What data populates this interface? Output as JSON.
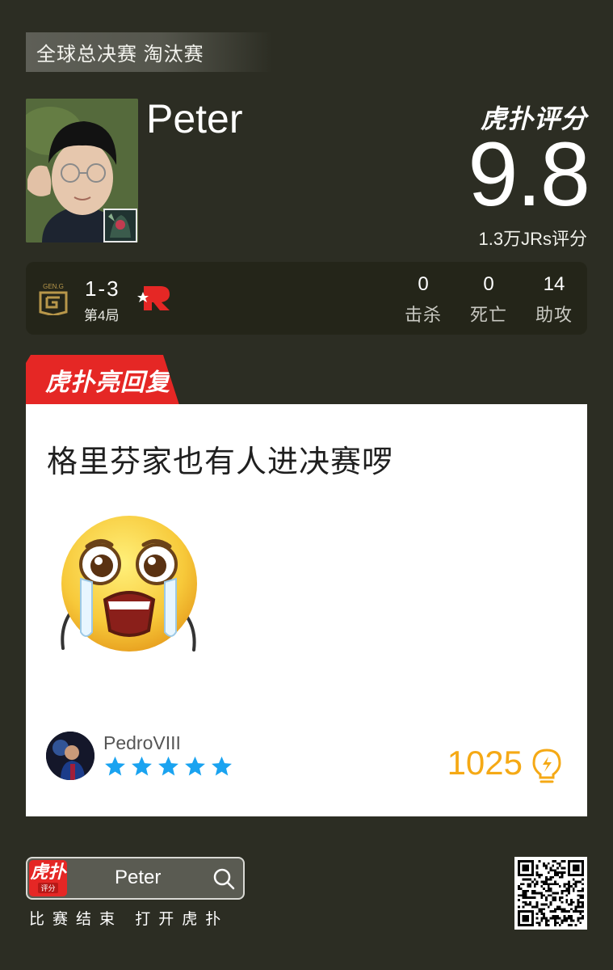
{
  "stage": "全球总决赛 淘汰赛",
  "player": {
    "name": "Peter"
  },
  "rating": {
    "brand": "虎扑评分",
    "score": "9.8",
    "jrs_count": "1.3万JRs评分"
  },
  "match": {
    "team_a": "Gen.G",
    "team_b": "KT Rolster",
    "score": "1-3",
    "game": "第4局",
    "stats": [
      {
        "value": "0",
        "label": "击杀"
      },
      {
        "value": "0",
        "label": "死亡"
      },
      {
        "value": "14",
        "label": "助攻"
      }
    ]
  },
  "reply": {
    "tab_label": "虎扑亮回复",
    "text": "格里芬家也有人进决赛啰",
    "user": "PedroVIII",
    "stars": 5,
    "likes": "1025"
  },
  "footer": {
    "app_name_big": "虎扑",
    "app_name_small": "评分",
    "search_text": "Peter",
    "caption": "比赛结束 打开虎扑"
  },
  "colors": {
    "background": "#2c2d23",
    "accent_red": "#e52725",
    "star_blue": "#1aa3f0",
    "likes_orange": "#f5a915"
  }
}
